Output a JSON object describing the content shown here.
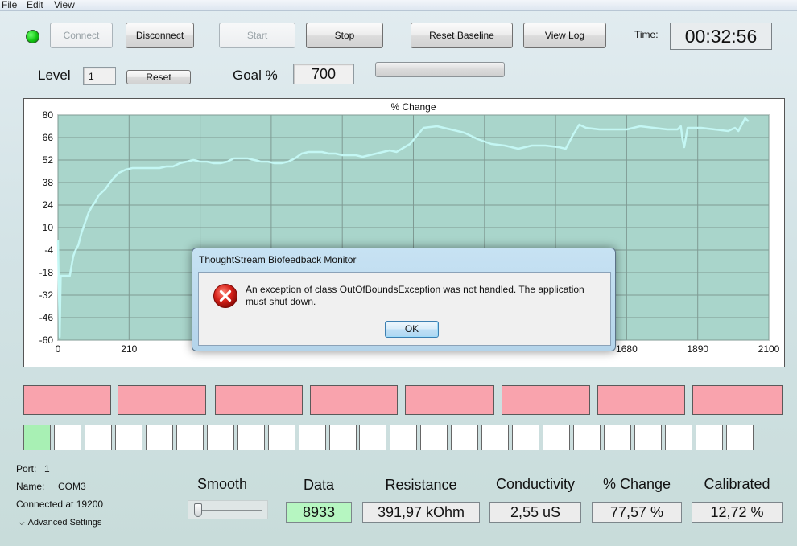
{
  "menu": {
    "file": "File",
    "edit": "Edit",
    "view": "View"
  },
  "toolbar": {
    "connect": "Connect",
    "disconnect": "Disconnect",
    "start": "Start",
    "stop": "Stop",
    "reset_baseline": "Reset Baseline",
    "view_log": "View Log",
    "time_label": "Time:",
    "time_value": "00:32:56"
  },
  "level": {
    "label": "Level",
    "value": "1",
    "reset": "Reset"
  },
  "goal": {
    "label": "Goal %",
    "value": "700",
    "progress": 0
  },
  "chart_data": {
    "type": "line",
    "title": "% Change",
    "xlabel": "",
    "ylabel": "",
    "xlim": [
      0,
      2100
    ],
    "ylim": [
      -60,
      80
    ],
    "x_ticks": [
      0,
      210,
      420,
      630,
      840,
      1050,
      1260,
      1470,
      1680,
      1890,
      2100
    ],
    "x_tick_labels_visible": [
      "0",
      "210",
      "1680",
      "1890",
      "2100"
    ],
    "y_ticks": [
      80,
      66,
      52,
      38,
      24,
      10,
      -4,
      -18,
      -32,
      -46,
      -60
    ],
    "grid": true,
    "line_color": "#c4f7f4",
    "plot_bg": "#a9d5cb",
    "series": [
      {
        "x": [
          0,
          5,
          8,
          15,
          20,
          25,
          35,
          45,
          50,
          60,
          70,
          80,
          90,
          100,
          110,
          120,
          130,
          140,
          150,
          165,
          180,
          200,
          220,
          240,
          260,
          280,
          300,
          320,
          340,
          360,
          380,
          400,
          420,
          440,
          460,
          480,
          500,
          520,
          540,
          560,
          580,
          600,
          620,
          640,
          660,
          680,
          700,
          720,
          740,
          760,
          780,
          800,
          820,
          840,
          860,
          880,
          900,
          920,
          940,
          960,
          980,
          1000,
          1040,
          1080,
          1120,
          1160,
          1200,
          1240,
          1280,
          1320,
          1360,
          1400,
          1440,
          1480,
          1500,
          1520,
          1540,
          1560,
          1600,
          1640,
          1680,
          1720,
          1760,
          1800,
          1830,
          1840,
          1845,
          1850,
          1860,
          1900,
          1940,
          1980,
          2000,
          2010,
          2030,
          2040
        ],
        "y": [
          2,
          -58,
          -20,
          -20,
          -20,
          -20,
          -20,
          -8,
          -5,
          -1,
          7,
          13,
          19,
          23,
          26,
          30,
          32,
          34,
          37,
          41,
          44,
          46,
          47,
          47,
          47,
          47,
          47,
          48,
          48,
          50,
          51,
          52,
          51,
          51,
          50,
          50,
          51,
          53,
          53,
          53,
          52,
          51,
          51,
          50,
          50,
          51,
          53,
          56,
          57,
          57,
          57,
          56,
          56,
          55,
          55,
          55,
          54,
          55,
          56,
          57,
          58,
          57,
          62,
          72,
          73,
          71,
          69,
          65,
          62,
          61,
          59,
          61,
          61,
          60,
          59,
          67,
          74,
          72,
          71,
          71,
          71,
          73,
          72,
          71,
          71,
          73,
          65,
          60,
          72,
          72,
          71,
          70,
          72,
          70,
          78,
          76
        ]
      }
    ]
  },
  "indicators": {
    "pink_count": 8,
    "cells_count": 24,
    "active_cell_index": 0
  },
  "port_info": {
    "port_label": "Port:",
    "port_value": "1",
    "name_label": "Name:",
    "name_value": "COM3",
    "connected": "Connected at 19200",
    "advanced": "Advanced Settings"
  },
  "smooth": {
    "label": "Smooth",
    "level": 0.0
  },
  "metrics": [
    {
      "label": "Data",
      "value": "8933"
    },
    {
      "label": "Resistance",
      "value": "391,97 kOhm"
    },
    {
      "label": "Conductivity",
      "value": "2,55 uS"
    },
    {
      "label": "% Change",
      "value": "77,57 %"
    },
    {
      "label": "Calibrated",
      "value": "12,72 %"
    }
  ],
  "dialog": {
    "title": "ThoughtStream Biofeedback Monitor",
    "message": "An exception of class OutOfBoundsException was not handled.  The application must shut down.",
    "ok": "OK"
  }
}
